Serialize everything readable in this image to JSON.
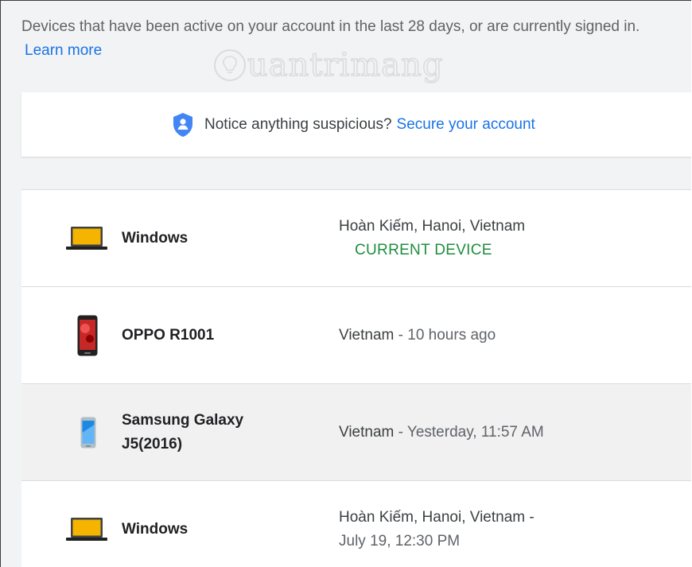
{
  "intro": {
    "text": "Devices that have been active on your account in the last 28 days, or are currently signed in.",
    "learn_more": "Learn more"
  },
  "watermark": {
    "text": "uantrimang",
    "icon": "lightbulb-icon"
  },
  "notice": {
    "icon": "shield-icon",
    "text": "Notice anything suspicious?",
    "link": "Secure your account"
  },
  "devices": [
    {
      "icon": "laptop-icon",
      "name": "Windows",
      "location": "Hoàn Kiếm, Hanoi, Vietnam",
      "separator": "",
      "time": "",
      "status": "CURRENT DEVICE"
    },
    {
      "icon": "phone-icon",
      "name": "OPPO R1001",
      "location": "Vietnam",
      "separator": " - ",
      "time": "10 hours ago",
      "status": ""
    },
    {
      "icon": "phone-icon",
      "name": "Samsung Galaxy J5(2016)",
      "location": "Vietnam",
      "separator": " - ",
      "time": "Yesterday, 11:57 AM",
      "status": ""
    },
    {
      "icon": "laptop-icon",
      "name": "Windows",
      "location": "Hoàn Kiếm, Hanoi, Vietnam -",
      "separator": "",
      "time": "July 19, 12:30 PM",
      "status": ""
    }
  ],
  "colors": {
    "link": "#1a73e8",
    "current": "#1e8e3e",
    "laptop": "#f4b400",
    "shield": "#4285f4"
  }
}
